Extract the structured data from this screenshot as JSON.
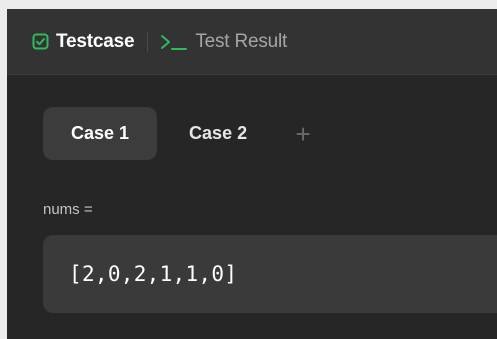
{
  "tabs": [
    {
      "label": "Testcase",
      "icon": "checkbox-icon",
      "active": true,
      "icon_color": "#2cbb5d"
    },
    {
      "label": "Test Result",
      "icon": "terminal-prompt-icon",
      "active": false,
      "icon_color": "#2cbb5d"
    }
  ],
  "cases": {
    "items": [
      {
        "label": "Case 1",
        "active": true
      },
      {
        "label": "Case 2",
        "active": false
      }
    ],
    "add_label": "+"
  },
  "param": {
    "label": "nums =",
    "value": "[2,0,2,1,1,0]"
  },
  "colors": {
    "accent_green": "#2cbb5d",
    "background": "#262626",
    "tabbar": "#333333",
    "input_bg": "#3a3a3a"
  }
}
